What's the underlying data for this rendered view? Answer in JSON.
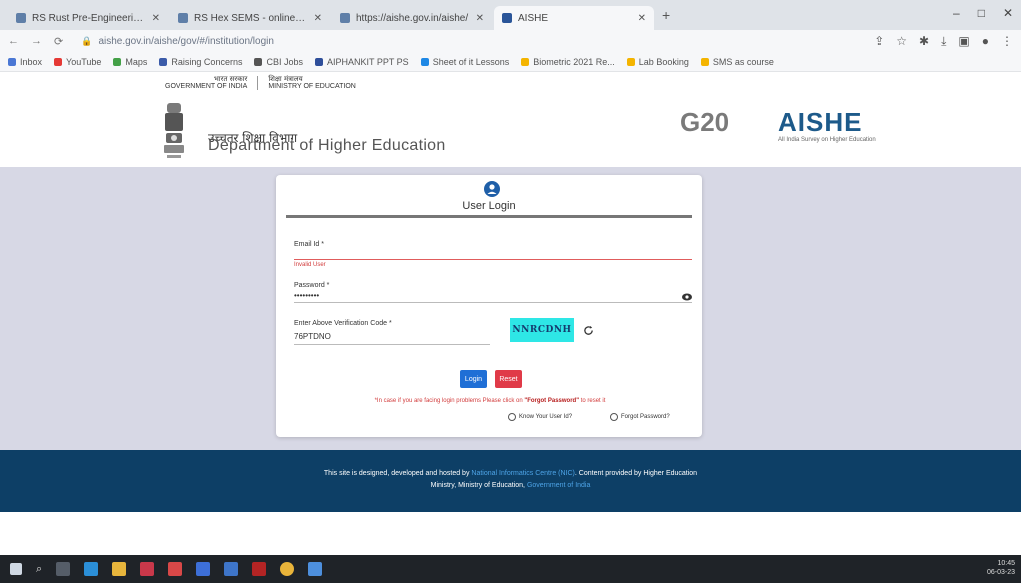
{
  "browser": {
    "tabs": [
      {
        "label": "RS Rust Pre-Engineering Exp |",
        "active": false
      },
      {
        "label": "RS Hex SEMS - online class |",
        "active": false
      },
      {
        "label": "https://aishe.gov.in/aishe/",
        "active": false
      },
      {
        "label": "AISHE",
        "active": true
      }
    ],
    "new_tab": "+",
    "window_buttons": [
      "–",
      "□",
      "✕"
    ],
    "url": "aishe.gov.in/aishe/gov/#/institution/login",
    "bookmarks": [
      {
        "label": "Inbox",
        "color": "#4a77d4"
      },
      {
        "label": "YouTube",
        "color": "#e53935"
      },
      {
        "label": "Maps",
        "color": "#43a047"
      },
      {
        "label": "Raising Concerns",
        "color": "#3b5ba9"
      },
      {
        "label": "CBI Jobs",
        "color": "#555555"
      },
      {
        "label": "AIPHANKIT PPT PS",
        "color": "#2e4e9a"
      },
      {
        "label": "Sheet of it Lessons",
        "color": "#1e88e5"
      },
      {
        "label": "Biometric 2021 Re...",
        "color": "#f4b400"
      },
      {
        "label": "Lab Booking",
        "color": "#f4b400"
      },
      {
        "label": "SMS as course",
        "color": "#f4b400"
      }
    ]
  },
  "gov_strip": {
    "left_line1": "भारत सरकार",
    "left_line2": "GOVERNMENT OF INDIA",
    "right_line1": "शिक्षा मंत्रालय",
    "right_line2": "MINISTRY OF EDUCATION"
  },
  "brand": {
    "dept_hindi": "उच्चतर शिक्षा विभाग",
    "dept_english": "Department of Higher Education",
    "g20": "G20",
    "aishe": "AISHE",
    "aishe_sub": "All India Survey on Higher Education"
  },
  "login": {
    "title": "User Login",
    "user_id_label": "Email Id *",
    "user_id_error": "Invalid User",
    "password_label": "Password *",
    "password_value": "•••••••••",
    "captcha_label": "Enter Above Verification Code *",
    "captcha_value": "76PTDNO",
    "captcha_image": "NNRCDNH",
    "login_button": "Login",
    "reset_button": "Reset",
    "notice_prefix": "*In case if you are facing login problems Please click on ",
    "notice_link": "\"Forgot Password\"",
    "notice_suffix": " to reset it",
    "option_show_user": "Know Your User Id?",
    "option_forgot": "Forgot Password?"
  },
  "footer": {
    "line1_a": "This site is designed, developed and hosted by ",
    "line1_link": "National Informatics Centre (NIC)",
    "line1_b": ". Content provided by Higher Education",
    "line2_a": "Ministry, Ministry of Education, ",
    "line2_link": "Government of India"
  },
  "taskbar": {
    "time": "10:45",
    "date": "06-03-23"
  }
}
